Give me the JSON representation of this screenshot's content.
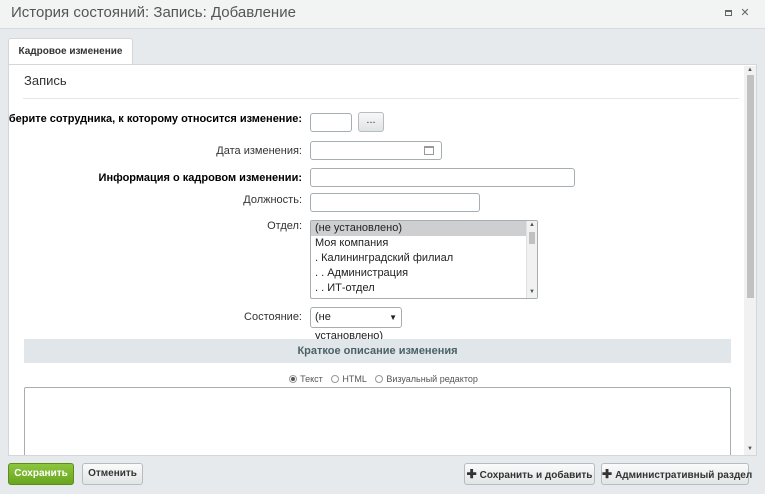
{
  "window": {
    "title": "История состояний: Запись: Добавление"
  },
  "tabs": [
    {
      "label": "Кадровое изменение"
    }
  ],
  "section": {
    "title": "Запись"
  },
  "form": {
    "employee_label": "Выберите сотрудника, к которому относится изменение:",
    "employee_button": "...",
    "date_label": "Дата изменения:",
    "info_label": "Информация о кадровом изменении:",
    "position_label": "Должность:",
    "department_label": "Отдел:",
    "department_options": [
      "(не установлено)",
      "Моя компания",
      ". Калининградский филиал",
      ". . Администрация",
      ". . ИТ-отдел"
    ],
    "state_label": "Состояние:",
    "state_value": "(не установлено)"
  },
  "description": {
    "header": "Краткое описание изменения",
    "editor_modes": [
      "Текст",
      "HTML",
      "Визуальный редактор"
    ],
    "selected_mode": "Текст"
  },
  "footer": {
    "save": "Сохранить",
    "cancel": "Отменить",
    "save_add": "Сохранить и добавить",
    "admin": "Административный раздел"
  },
  "colors": {
    "save_button": "#7db52f",
    "subheader_bg": "#e0e6e9"
  },
  "icons": [
    "maximize-icon",
    "close-icon",
    "calendar-icon",
    "plus-icon"
  ]
}
